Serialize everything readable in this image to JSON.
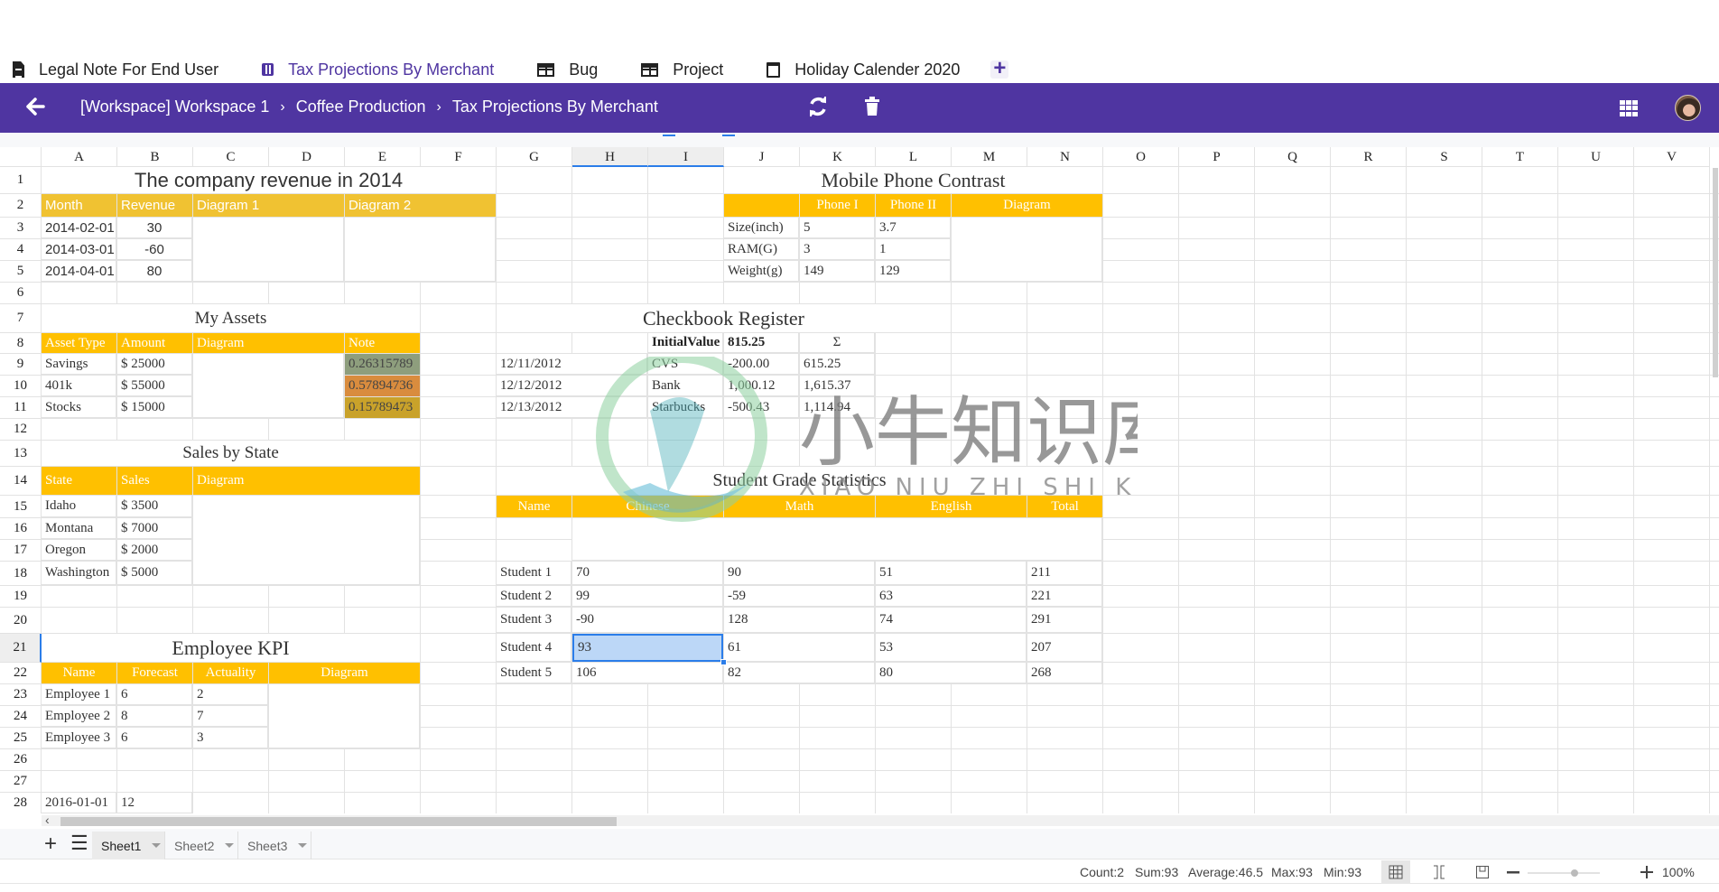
{
  "tabs": [
    {
      "label": "Legal Note For End User",
      "icon": "document-icon",
      "active": false
    },
    {
      "label": "Tax Projections By Merchant",
      "icon": "calculator-icon",
      "active": true
    },
    {
      "label": "Bug",
      "icon": "table-icon",
      "active": false
    },
    {
      "label": "Project",
      "icon": "table-icon",
      "active": false
    },
    {
      "label": "Holiday Calender 2020",
      "icon": "calendar-icon",
      "active": false
    }
  ],
  "tab_add": "+",
  "topbar": {
    "back": "🡐",
    "breadcrumb": [
      "[Workspace] Workspace 1",
      "Coffee Production",
      "Tax Projections By Merchant"
    ],
    "separator": "›",
    "accent": "#4f35a1"
  },
  "columns": [
    "A",
    "B",
    "C",
    "D",
    "E",
    "F",
    "G",
    "H",
    "I",
    "J",
    "K",
    "L",
    "M",
    "N",
    "O",
    "P",
    "Q",
    "R",
    "S",
    "T",
    "U",
    "V"
  ],
  "rows": [
    "1",
    "2",
    "3",
    "4",
    "5",
    "6",
    "7",
    "8",
    "9",
    "10",
    "11",
    "12",
    "13",
    "14",
    "15",
    "16",
    "17",
    "18",
    "19",
    "20",
    "21",
    "22",
    "23",
    "24",
    "25",
    "26",
    "27",
    "28"
  ],
  "selection": {
    "cell": "H21",
    "column": "H",
    "column2": "I",
    "row": "21"
  },
  "revenue": {
    "title": "The company revenue in 2014",
    "headers": [
      "Month",
      "Revenue",
      "Diagram 1",
      "Diagram 2"
    ],
    "rows": [
      [
        "2014-02-01",
        "30"
      ],
      [
        "2014-03-01",
        "-60"
      ],
      [
        "2014-04-01",
        "80"
      ]
    ]
  },
  "assets": {
    "title": "My Assets",
    "headers": [
      "Asset Type",
      "Amount",
      "Diagram",
      "Note"
    ],
    "rows": [
      {
        "type": "Savings",
        "amount": "$ 25000",
        "note": "0.26315789",
        "color": "#8e9e7d"
      },
      {
        "type": "401k",
        "amount": "$ 55000",
        "note": "0.57894736",
        "color": "#d98c3e"
      },
      {
        "type": "Stocks",
        "amount": "$ 15000",
        "note": "0.15789473",
        "color": "#c9a22a"
      }
    ]
  },
  "sales": {
    "title": "Sales by State",
    "headers": [
      "State",
      "Sales",
      "Diagram"
    ],
    "rows": [
      [
        "Idaho",
        "$ 3500"
      ],
      [
        "Montana",
        "$ 7000"
      ],
      [
        "Oregon",
        "$ 2000"
      ],
      [
        "Washington",
        "$ 5000"
      ]
    ]
  },
  "kpi": {
    "title": "Employee KPI",
    "headers": [
      "Name",
      "Forecast",
      "Actuality",
      "Diagram"
    ],
    "rows": [
      [
        "Employee 1",
        "6",
        "2"
      ],
      [
        "Employee 2",
        "8",
        "7"
      ],
      [
        "Employee 3",
        "6",
        "3"
      ]
    ],
    "extra": [
      "2016-01-01",
      "12"
    ]
  },
  "phone": {
    "title": "Mobile Phone Contrast",
    "headers": [
      "",
      "Phone I",
      "Phone II",
      "Diagram"
    ],
    "rows": [
      [
        "Size(inch)",
        "5",
        "3.7"
      ],
      [
        "RAM(G)",
        "3",
        "1"
      ],
      [
        "Weight(g)",
        "149",
        "129"
      ]
    ]
  },
  "checkbook": {
    "title": "Checkbook Register",
    "initial_label": "InitialValue",
    "initial_value": "815.25",
    "sigma": "Σ",
    "rows": [
      [
        "12/11/2012",
        "CVS",
        "-200.00",
        "615.25"
      ],
      [
        "12/12/2012",
        "Bank",
        "1,000.12",
        "1,615.37"
      ],
      [
        "12/13/2012",
        "Starbucks",
        "-500.43",
        "1,114.94"
      ]
    ]
  },
  "grades": {
    "title": "Student Grade Statistics",
    "headers": [
      "Name",
      "Chinese",
      "Math",
      "English",
      "Total"
    ],
    "rows": [
      [
        "Student 1",
        "70",
        "90",
        "51",
        "211"
      ],
      [
        "Student 2",
        "99",
        "-59",
        "63",
        "221"
      ],
      [
        "Student 3",
        "-90",
        "128",
        "74",
        "291"
      ],
      [
        "Student 4",
        "93",
        "61",
        "53",
        "207"
      ],
      [
        "Student 5",
        "106",
        "82",
        "80",
        "268"
      ]
    ]
  },
  "watermark": {
    "text": "小牛知识库",
    "subtext": "XIAO NIU ZHI SHI KU"
  },
  "sheets": [
    {
      "label": "Sheet1",
      "active": true
    },
    {
      "label": "Sheet2",
      "active": false
    },
    {
      "label": "Sheet3",
      "active": false
    }
  ],
  "status": {
    "count": "Count:2",
    "sum": "Sum:93",
    "average": "Average:46.5",
    "max": "Max:93",
    "min": "Min:93",
    "zoom": "100%",
    "zoom_level": 1.0
  }
}
